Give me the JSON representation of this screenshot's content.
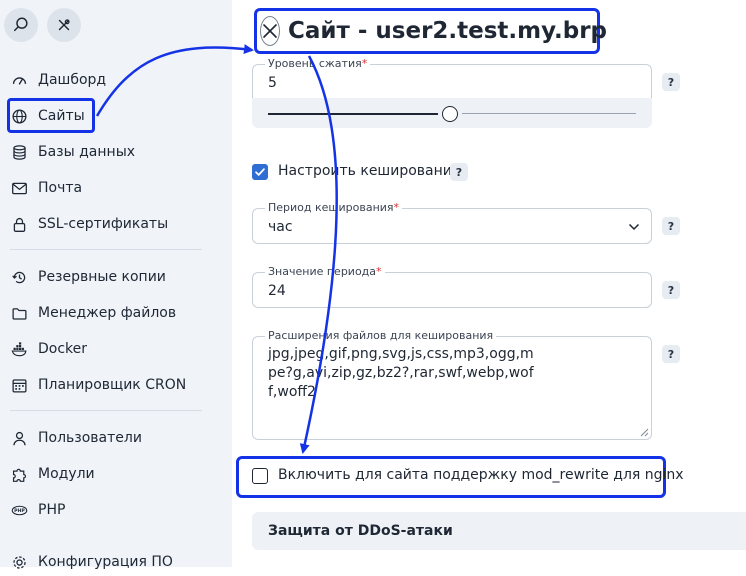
{
  "sidebar": {
    "search_icon": "search-icon",
    "settings_icon": "tools-icon",
    "items": [
      {
        "label": "Дашборд",
        "icon": "dashboard-icon"
      },
      {
        "label": "Сайты",
        "icon": "globe-icon"
      },
      {
        "label": "Базы данных",
        "icon": "database-icon"
      },
      {
        "label": "Почта",
        "icon": "mail-icon"
      },
      {
        "label": "SSL-сертификаты",
        "icon": "lock-icon"
      },
      {
        "label": "Резервные копии",
        "icon": "backup-icon"
      },
      {
        "label": "Менеджер файлов",
        "icon": "folder-icon"
      },
      {
        "label": "Docker",
        "icon": "docker-icon"
      },
      {
        "label": "Планировщик CRON",
        "icon": "calendar-icon"
      },
      {
        "label": "Пользователи",
        "icon": "user-icon"
      },
      {
        "label": "Модули",
        "icon": "puzzle-icon"
      },
      {
        "label": "PHP",
        "icon": "php-icon"
      },
      {
        "label": "Конфигурация ПО",
        "icon": "gear-icon"
      }
    ]
  },
  "dialog": {
    "title": "Сайт - user2.test.my.brp",
    "compression": {
      "label": "Уровень сжатия",
      "required_mark": "*",
      "value": "5",
      "slider_level": 0.5
    },
    "caching_toggle": {
      "label": "Настроить кеширование",
      "checked": true
    },
    "cache_period": {
      "label": "Период кеширования",
      "required_mark": "*",
      "value": "час"
    },
    "period_value": {
      "label": "Значение периода",
      "required_mark": "*",
      "value": "24"
    },
    "extensions": {
      "label": "Расширения файлов для кеширования",
      "value": "jpg,jpeg,gif,png,svg,js,css,mp3,ogg,mpe?g,avi,zip,gz,bz2?,rar,swf,webp,woff,woff2"
    },
    "mod_rewrite": {
      "label": "Включить для сайта поддержку mod_rewrite для nginx",
      "checked": false
    },
    "ddos_section": "Защита от DDoS-атаки",
    "help_mark": "?"
  },
  "colors": {
    "accent_highlight": "#1533e6",
    "checkbox_on": "#2f6fd4",
    "sidebar_bg": "#f0f4f9",
    "required": "#d93030"
  }
}
